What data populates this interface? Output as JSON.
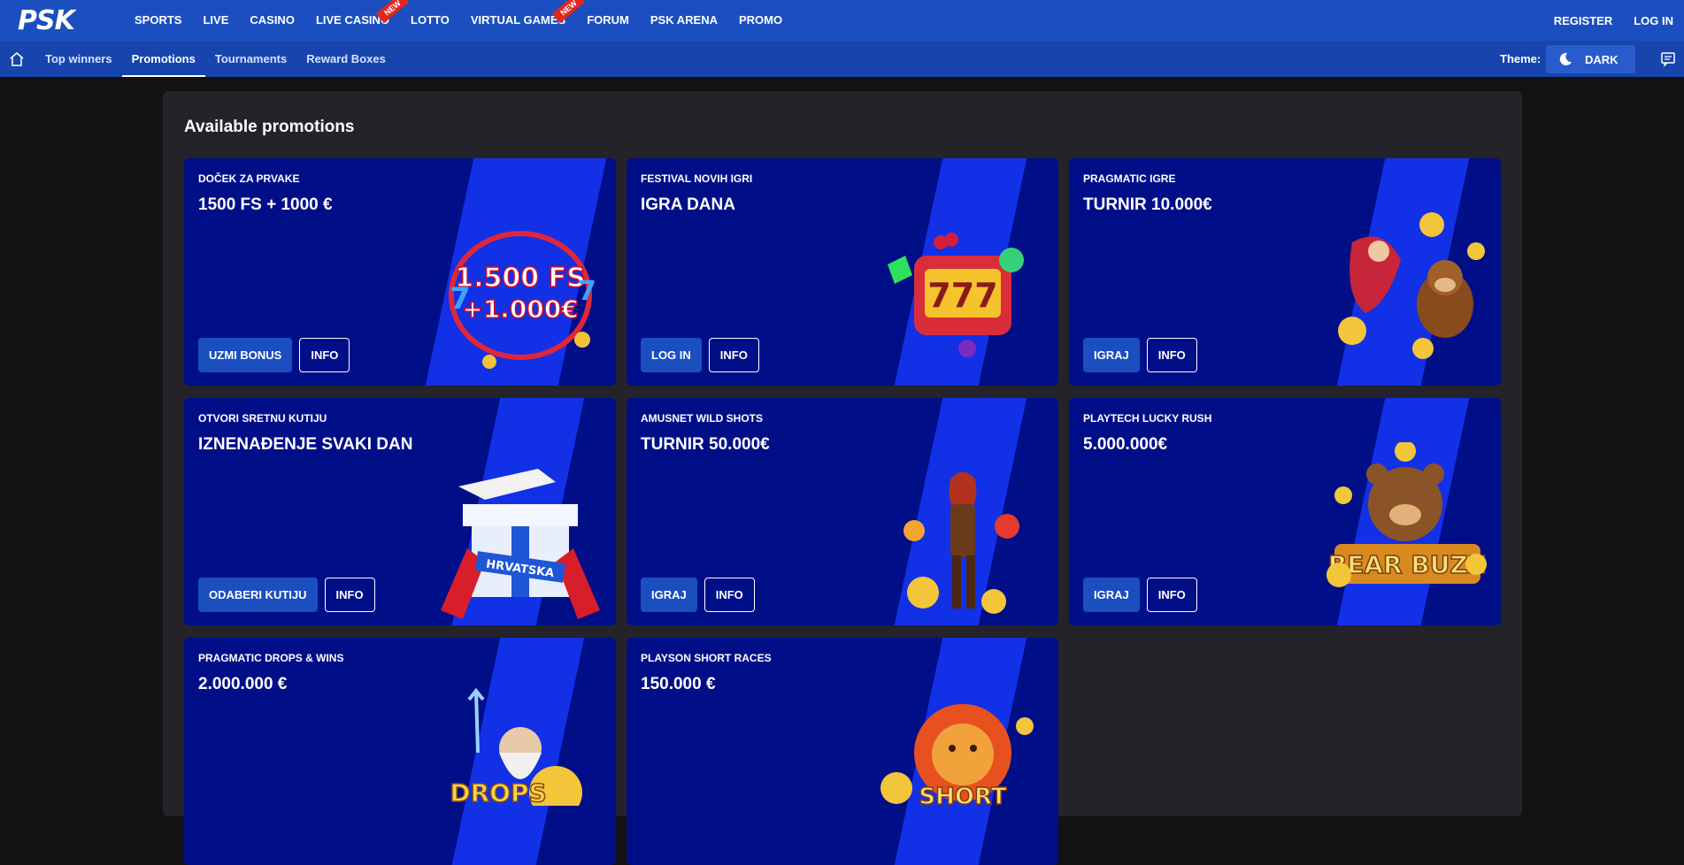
{
  "header": {
    "logo": "PSK",
    "nav": [
      {
        "label": "SPORTS",
        "badge": ""
      },
      {
        "label": "LIVE",
        "badge": ""
      },
      {
        "label": "CASINO",
        "badge": ""
      },
      {
        "label": "LIVE CASINO",
        "badge": "new"
      },
      {
        "label": "LOTTO",
        "badge": ""
      },
      {
        "label": "VIRTUAL GAMES",
        "badge": "new"
      },
      {
        "label": "FORUM",
        "badge": ""
      },
      {
        "label": "PSK ARENA",
        "badge": ""
      },
      {
        "label": "PROMO",
        "badge": ""
      }
    ],
    "register": "REGISTER",
    "login": "LOG IN"
  },
  "subnav": {
    "items": [
      "Top winners",
      "Promotions",
      "Tournaments",
      "Reward Boxes"
    ],
    "active": "Promotions",
    "theme_label": "Theme:",
    "theme_value": "DARK"
  },
  "main": {
    "title": "Available promotions",
    "cards": [
      {
        "subtitle": "DOČEK ZA PRVAKE",
        "title": "1500 FS + 1000 €",
        "primary": "UZMI BONUS",
        "info": "INFO",
        "art_text": "1.500 FS\n+1.000€"
      },
      {
        "subtitle": "FESTIVAL NOVIH IGRI",
        "title": "IGRA DANA",
        "primary": "LOG IN",
        "info": "INFO",
        "art_text": "777"
      },
      {
        "subtitle": "PRAGMATIC IGRE",
        "title": "TURNIR 10.000€",
        "primary": "IGRAJ",
        "info": "INFO",
        "art_text": ""
      },
      {
        "subtitle": "OTVORI SRETNU KUTIJU",
        "title": "IZNENAĐENJE SVAKI DAN",
        "primary": "ODABERI KUTIJU",
        "info": "INFO",
        "art_text": "HRVATSKA"
      },
      {
        "subtitle": "AMUSNET WILD SHOTS",
        "title": "TURNIR 50.000€",
        "primary": "IGRAJ",
        "info": "INFO",
        "art_text": ""
      },
      {
        "subtitle": "PLAYTECH LUCKY RUSH",
        "title": "5.000.000€",
        "primary": "IGRAJ",
        "info": "INFO",
        "art_text": "BEAR BUZZ"
      },
      {
        "subtitle": "PRAGMATIC DROPS & WINS",
        "title": "2.000.000 €",
        "primary": "",
        "info": "",
        "art_text": "DROPS"
      },
      {
        "subtitle": "PLAYSON SHORT RACES",
        "title": "150.000 €",
        "primary": "",
        "info": "",
        "art_text": "SHORT"
      }
    ]
  },
  "colors": {
    "topbar": "#1b4fbf",
    "subbar": "#1745ad",
    "card_bg": "#000f88",
    "card_stripe": "#1230e6",
    "panel": "#232329"
  },
  "icons": {
    "home": "home-icon",
    "theme": "moon-icon",
    "chat": "chat-icon"
  }
}
